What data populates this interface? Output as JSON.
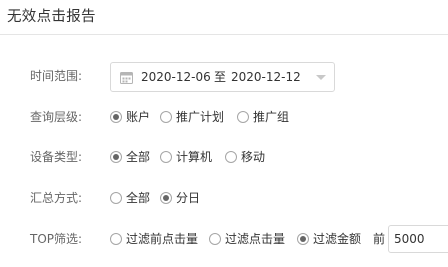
{
  "page": {
    "title": "无效点击报告"
  },
  "time_range": {
    "label": "时间范围:",
    "start": "2020-12-06",
    "separator": "至",
    "end": "2020-12-12"
  },
  "query_level": {
    "label": "查询层级:",
    "options": [
      "账户",
      "推广计划",
      "推广组"
    ],
    "selected": "账户"
  },
  "device_type": {
    "label": "设备类型:",
    "options": [
      "全部",
      "计算机",
      "移动"
    ],
    "selected": "全部"
  },
  "aggregation": {
    "label": "汇总方式:",
    "options": [
      "全部",
      "分日"
    ],
    "selected": "分日"
  },
  "top_filter": {
    "label": "TOP筛选:",
    "options": [
      "过滤前点击量",
      "过滤点击量",
      "过滤金额"
    ],
    "selected": "过滤金额",
    "prefix": "前",
    "value": "5000"
  },
  "icons": {
    "calendar": "calendar-icon",
    "dropdown": "chevron-down-icon"
  },
  "colors": {
    "text": "#333333",
    "label": "#666666",
    "border": "#d9d9d9",
    "radio_dot": "#666666"
  }
}
